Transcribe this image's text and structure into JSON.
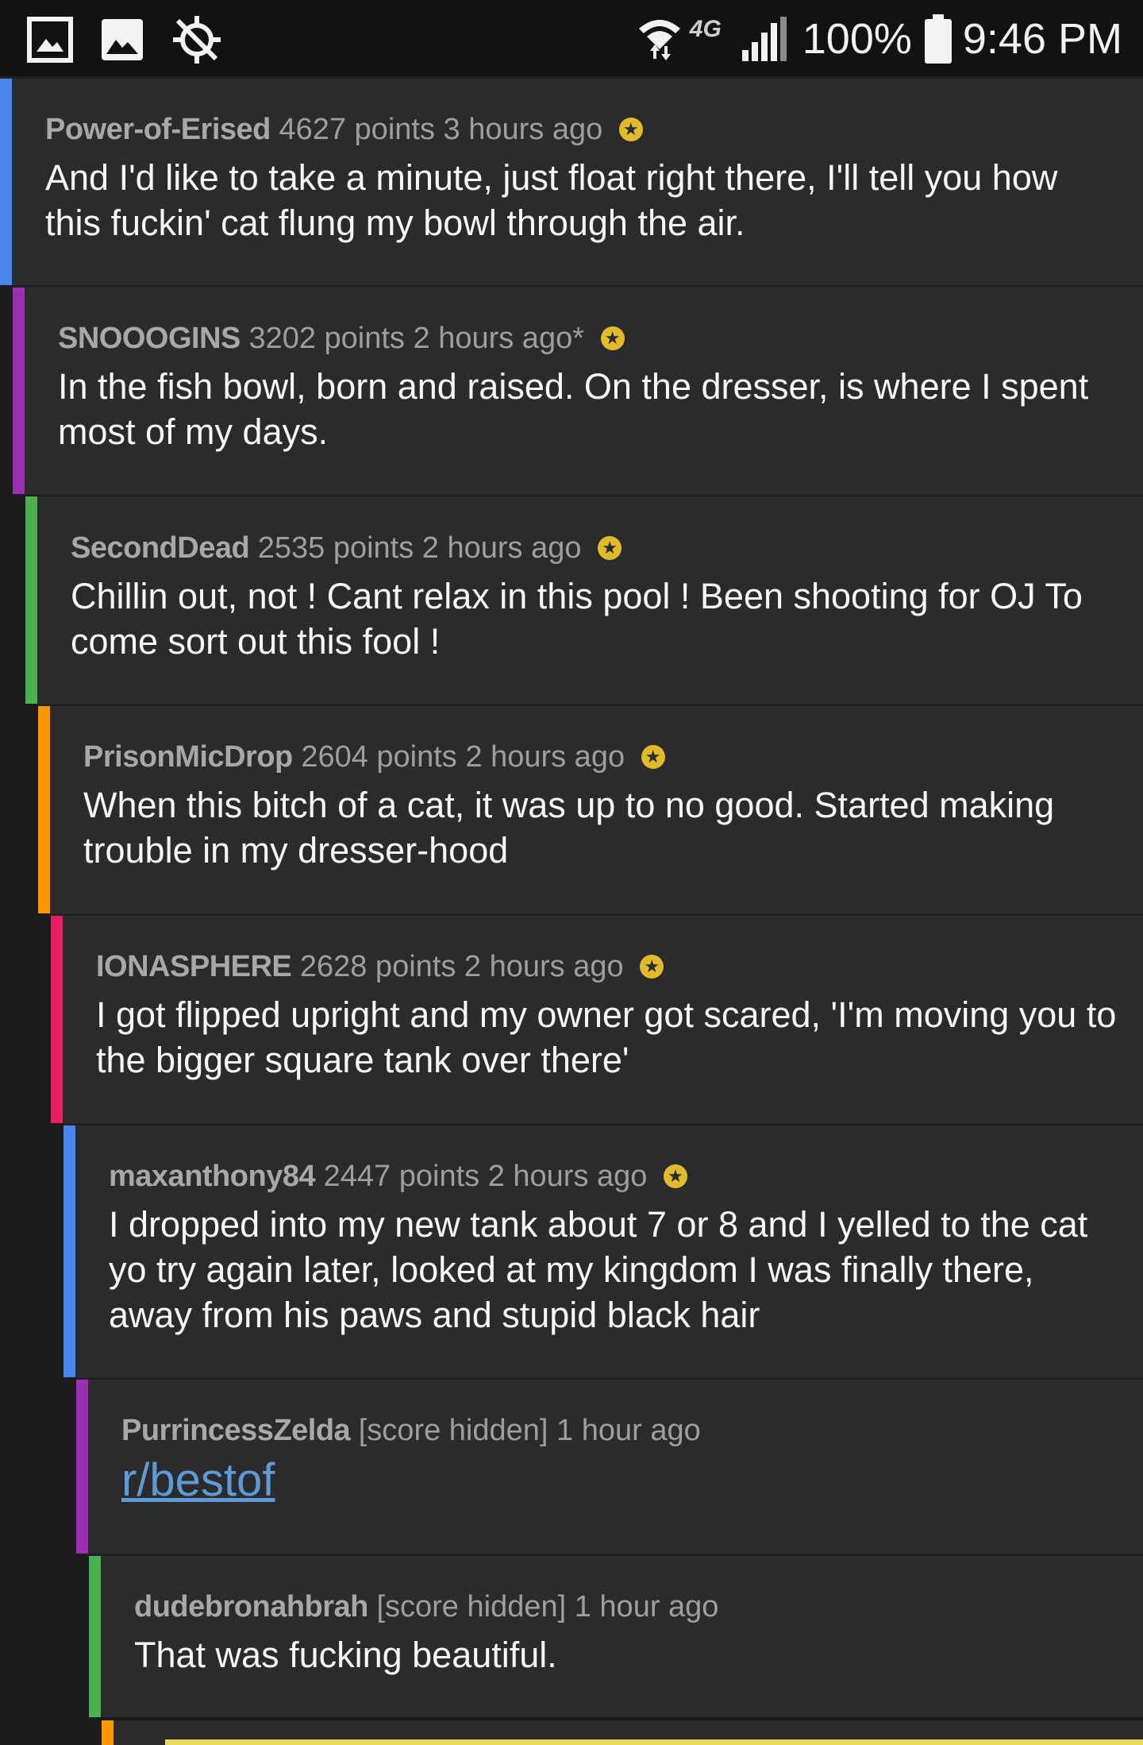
{
  "status_bar": {
    "battery": "100%",
    "time": "9:46 PM",
    "network": "4G"
  },
  "colors": {
    "level_blue": "#4a86f0",
    "level_purple": "#9c2fb3",
    "level_green": "#4caf50",
    "level_orange": "#ff9800",
    "level_pink": "#e91e63",
    "gild": "#e2bb2d",
    "link": "#5e9bd4"
  },
  "comments": [
    {
      "author": "Power-of-Erised",
      "score": "4627 points",
      "age": "3 hours ago",
      "gilded": true,
      "text": "And I'd like to take a minute, just float right there, I'll tell you how this fuckin' cat flung my bowl through the air."
    },
    {
      "author": "SNOOOGINS",
      "score": "3202 points",
      "age": "2 hours ago*",
      "gilded": true,
      "text": "In the fish bowl, born and raised. On the dresser, is where I spent most of my days."
    },
    {
      "author": "SecondDead",
      "score": "2535 points",
      "age": "2 hours ago",
      "gilded": true,
      "text": "Chillin out, not ! Cant relax in this pool ! Been shooting for OJ To come sort out this fool !"
    },
    {
      "author": "PrisonMicDrop",
      "score": "2604 points",
      "age": "2 hours ago",
      "gilded": true,
      "text": "When this bitch of a cat, it was up to no good. Started making trouble in my dresser-hood"
    },
    {
      "author": "IONASPHERE",
      "score": "2628 points",
      "age": "2 hours ago",
      "gilded": true,
      "text": "I got flipped upright and my owner got scared, 'I'm moving you to the bigger square tank over there'"
    },
    {
      "author": "maxanthony84",
      "score": "2447 points",
      "age": "2 hours ago",
      "gilded": true,
      "text": "I dropped into my new tank about 7 or 8 and I yelled to the cat yo try again later, looked at my kingdom I was finally there, away from his paws and stupid black hair"
    },
    {
      "author": "PurrincessZelda",
      "score": "[score hidden]",
      "age": "1 hour ago",
      "gilded": false,
      "link": "r/bestof"
    },
    {
      "author": "dudebronahbrah",
      "score": "[score hidden]",
      "age": "1 hour ago",
      "gilded": false,
      "text": "That was fucking beautiful."
    }
  ]
}
